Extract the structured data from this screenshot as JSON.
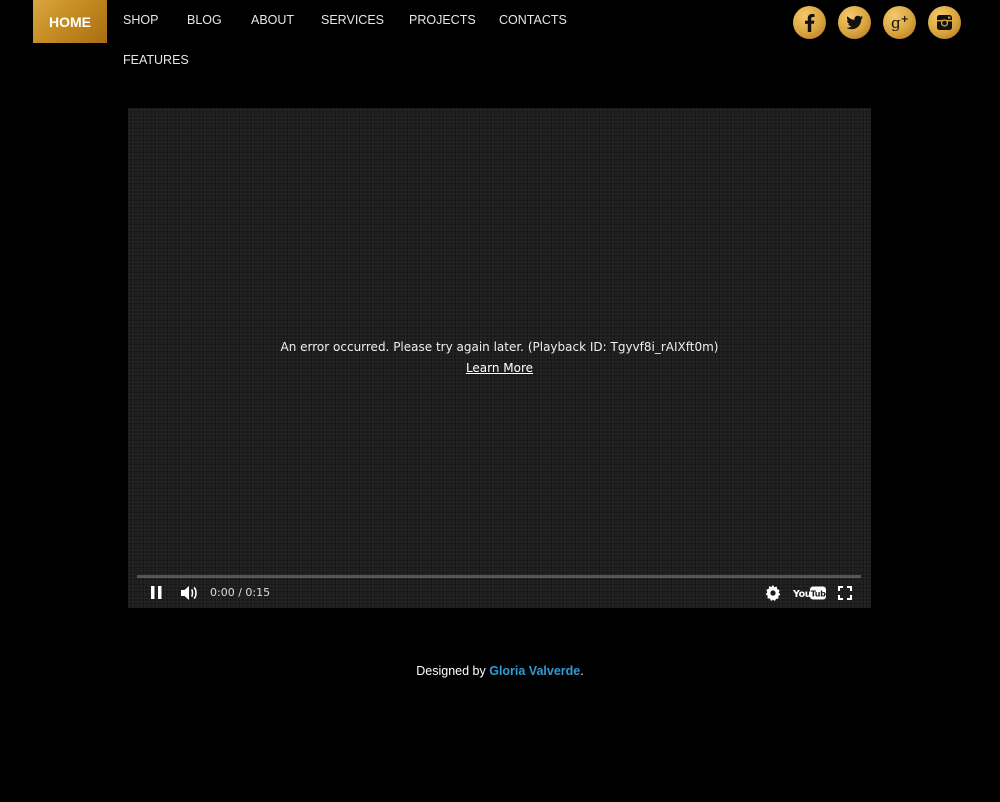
{
  "nav": {
    "home": "HOME",
    "items": [
      "SHOP",
      "BLOG",
      "ABOUT",
      "SERVICES",
      "PROJECTS",
      "CONTACTS",
      "FEATURES"
    ]
  },
  "social": [
    {
      "icon": "facebook-icon",
      "glyph": "f"
    },
    {
      "icon": "twitter-icon",
      "glyph": "bird"
    },
    {
      "icon": "google-plus-icon",
      "glyph": "g+"
    },
    {
      "icon": "instagram-icon",
      "glyph": "camera"
    }
  ],
  "video": {
    "error_message": "An error occurred. Please try again later. (Playback ID: Tgyvf8i_rAIXft0m)",
    "learn_more": "Learn More",
    "time": "0:00 / 0:15",
    "progress": 0
  },
  "footer": {
    "prefix": "Designed by ",
    "author": "Gloria Valverde",
    "suffix": "."
  },
  "colors": {
    "accent_gold": "#c9922b",
    "link_blue": "#2f9ad6",
    "background": "#000000"
  }
}
